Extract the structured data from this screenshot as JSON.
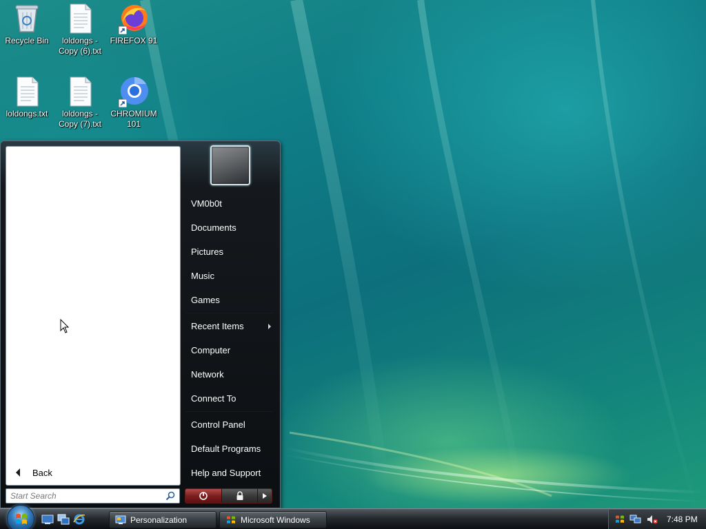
{
  "desktop": {
    "icons": [
      {
        "label_lines": [
          "Recycle Bin"
        ],
        "icon": "recycle-bin-icon"
      },
      {
        "label_lines": [
          "loldongs -",
          "Copy (6).txt"
        ],
        "icon": "text-file-icon"
      },
      {
        "label_lines": [
          "FIREFOX 91"
        ],
        "icon": "firefox-icon"
      },
      {
        "label_lines": [
          "loldongs.txt"
        ],
        "icon": "text-file-icon"
      },
      {
        "label_lines": [
          "loldongs -",
          "Copy (7).txt"
        ],
        "icon": "text-file-icon"
      },
      {
        "label_lines": [
          "CHROMIUM",
          "101"
        ],
        "icon": "chromium-icon"
      }
    ]
  },
  "start_menu": {
    "back_label": "Back",
    "search_placeholder": "Start Search",
    "items": [
      {
        "label": "VM0b0t"
      },
      {
        "label": "Documents"
      },
      {
        "label": "Pictures"
      },
      {
        "label": "Music"
      },
      {
        "label": "Games"
      },
      {
        "label": "Recent Items",
        "submenu": true
      },
      {
        "label": "Computer"
      },
      {
        "label": "Network"
      },
      {
        "label": "Connect To"
      },
      {
        "label": "Control Panel"
      },
      {
        "label": "Default Programs"
      },
      {
        "label": "Help and Support"
      }
    ]
  },
  "taskbar": {
    "buttons": [
      {
        "label": "Personalization",
        "icon": "personalization-icon"
      },
      {
        "label": "Microsoft Windows",
        "icon": "windows-flag-icon"
      }
    ],
    "clock": "7:48 PM"
  },
  "colors": {
    "accent_power": "#8b2a2a",
    "menu_text": "#ffffff",
    "wallpaper": "#117f86"
  }
}
